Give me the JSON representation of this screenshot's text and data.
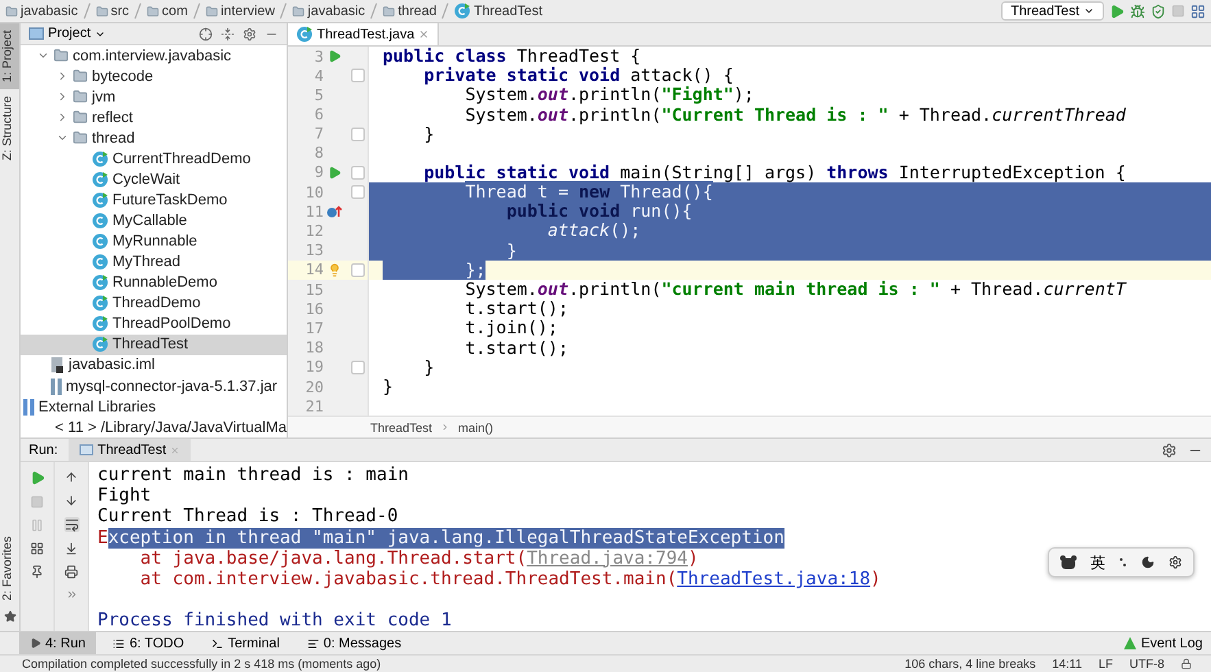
{
  "navigation_bar": {
    "crumbs": [
      "javabasic",
      "src",
      "com",
      "interview",
      "javabasic",
      "thread",
      "ThreadTest"
    ],
    "run_config": "ThreadTest"
  },
  "left_tool_stripe": {
    "top": [
      {
        "label": "1: Project",
        "selected": true
      },
      {
        "label": "Z: Structure",
        "selected": false
      }
    ],
    "bottom": [
      {
        "label": "2: Favorites",
        "selected": false
      }
    ]
  },
  "project_panel": {
    "title": "Project",
    "tree": [
      {
        "label": "com.interview.javabasic",
        "kind": "package",
        "expanded": true,
        "selected": false,
        "children": [
          {
            "label": "bytecode",
            "kind": "package",
            "expanded": false,
            "selected": false
          },
          {
            "label": "jvm",
            "kind": "package",
            "expanded": false,
            "selected": false
          },
          {
            "label": "reflect",
            "kind": "package",
            "expanded": false,
            "selected": false
          },
          {
            "label": "thread",
            "kind": "package",
            "expanded": true,
            "selected": false,
            "children": [
              {
                "label": "CurrentThreadDemo",
                "kind": "runnable-class",
                "selected": false
              },
              {
                "label": "CycleWait",
                "kind": "runnable-class",
                "selected": false
              },
              {
                "label": "FutureTaskDemo",
                "kind": "runnable-class",
                "selected": false
              },
              {
                "label": "MyCallable",
                "kind": "class",
                "selected": false
              },
              {
                "label": "MyRunnable",
                "kind": "class",
                "selected": false
              },
              {
                "label": "MyThread",
                "kind": "class",
                "selected": false
              },
              {
                "label": "RunnableDemo",
                "kind": "runnable-class",
                "selected": false
              },
              {
                "label": "ThreadDemo",
                "kind": "runnable-class",
                "selected": false
              },
              {
                "label": "ThreadPoolDemo",
                "kind": "runnable-class",
                "selected": false
              },
              {
                "label": "ThreadTest",
                "kind": "runnable-class",
                "selected": true
              }
            ]
          }
        ]
      },
      {
        "label": "javabasic.iml",
        "kind": "iml",
        "selected": false
      },
      {
        "label": "mysql-connector-java-5.1.37.jar",
        "kind": "jar",
        "selected": false
      },
      {
        "label": "External Libraries",
        "kind": "libraries",
        "selected": false
      },
      {
        "label": "< 11 >  /Library/Java/JavaVirtualMa",
        "kind": "sdk",
        "selected": false
      }
    ]
  },
  "editor": {
    "tabs": [
      {
        "label": "ThreadTest.java",
        "selected": true
      }
    ],
    "lines": [
      {
        "number": "3",
        "gutter_icon": {
          "kind": "run"
        },
        "tokens": [
          {
            "text": "public class ",
            "kind": "keyword"
          },
          {
            "text": "ThreadTest {",
            "kind": "plain"
          }
        ]
      },
      {
        "number": "4",
        "fold": true,
        "tokens": [
          {
            "text": "    private static void ",
            "kind": "keyword"
          },
          {
            "text": "attack() {",
            "kind": "plain"
          }
        ]
      },
      {
        "number": "5",
        "tokens": [
          {
            "text": "        System.",
            "kind": "plain"
          },
          {
            "text": "out",
            "kind": "field"
          },
          {
            "text": ".println(",
            "kind": "plain"
          },
          {
            "text": "\"Fight\"",
            "kind": "string"
          },
          {
            "text": ");",
            "kind": "plain"
          }
        ]
      },
      {
        "number": "6",
        "tokens": [
          {
            "text": "        System.",
            "kind": "plain"
          },
          {
            "text": "out",
            "kind": "field"
          },
          {
            "text": ".println(",
            "kind": "plain"
          },
          {
            "text": "\"Current Thread is : \"",
            "kind": "string"
          },
          {
            "text": " + Thread.",
            "kind": "plain"
          },
          {
            "text": "currentThread",
            "kind": "call"
          }
        ]
      },
      {
        "number": "7",
        "fold": true,
        "tokens": [
          {
            "text": "    }",
            "kind": "plain"
          }
        ]
      },
      {
        "number": "8"
      },
      {
        "number": "9",
        "gutter_icon": {
          "kind": "run"
        },
        "fold": true,
        "tokens": [
          {
            "text": "    public static void ",
            "kind": "keyword"
          },
          {
            "text": "main(String[] args) ",
            "kind": "plain"
          },
          {
            "text": "throws ",
            "kind": "keyword"
          },
          {
            "text": "InterruptedException {",
            "kind": "plain"
          }
        ]
      },
      {
        "number": "10",
        "fold": true,
        "to_end": true,
        "tokens": [
          {
            "text": "        Thread t = ",
            "kind": "plain",
            "selected": true
          },
          {
            "text": "new ",
            "kind": "keyword",
            "selected": true
          },
          {
            "text": "Thread(){",
            "kind": "plain",
            "selected": true
          }
        ]
      },
      {
        "number": "11",
        "gutter_icon": {
          "kind": "override"
        },
        "to_end": true,
        "tokens": [
          {
            "text": "            public void ",
            "kind": "keyword",
            "selected": true
          },
          {
            "text": "run(){",
            "kind": "plain",
            "selected": true
          }
        ]
      },
      {
        "number": "12",
        "to_end": true,
        "tokens": [
          {
            "text": "                attack",
            "kind": "call",
            "selected": true
          },
          {
            "text": "();",
            "kind": "plain",
            "selected": true
          }
        ]
      },
      {
        "number": "13",
        "to_end": true,
        "tokens": [
          {
            "text": "            }",
            "kind": "plain",
            "selected": true
          }
        ]
      },
      {
        "number": "14",
        "gutter_icon": {
          "kind": "bulb"
        },
        "fold": true,
        "current": true,
        "to_end": false,
        "tokens": [
          {
            "text": "        };",
            "kind": "plain",
            "selected": true
          }
        ]
      },
      {
        "number": "15",
        "tokens": [
          {
            "text": "        System.",
            "kind": "plain"
          },
          {
            "text": "out",
            "kind": "field"
          },
          {
            "text": ".println(",
            "kind": "plain"
          },
          {
            "text": "\"current main thread is : \"",
            "kind": "string"
          },
          {
            "text": " + Thread.",
            "kind": "plain"
          },
          {
            "text": "currentT",
            "kind": "call"
          }
        ]
      },
      {
        "number": "16",
        "tokens": [
          {
            "text": "        t.start();",
            "kind": "plain"
          }
        ]
      },
      {
        "number": "17",
        "tokens": [
          {
            "text": "        t.join();",
            "kind": "plain"
          }
        ]
      },
      {
        "number": "18",
        "tokens": [
          {
            "text": "        t.start();",
            "kind": "plain"
          }
        ]
      },
      {
        "number": "19",
        "fold": true,
        "tokens": [
          {
            "text": "    }",
            "kind": "plain"
          }
        ]
      },
      {
        "number": "20",
        "tokens": [
          {
            "text": "}",
            "kind": "plain"
          }
        ]
      },
      {
        "number": "21"
      }
    ],
    "breadcrumbs": [
      "ThreadTest",
      "main()"
    ]
  },
  "run_panel": {
    "label": "Run:",
    "tabs": [
      {
        "label": "ThreadTest",
        "selected": true
      }
    ],
    "console": [
      {
        "tokens": [
          {
            "text": "current main thread is : main",
            "kind": "output"
          }
        ]
      },
      {
        "tokens": [
          {
            "text": "Fight",
            "kind": "output"
          }
        ]
      },
      {
        "tokens": [
          {
            "text": "Current Thread is : Thread-0",
            "kind": "output"
          }
        ]
      },
      {
        "tokens": [
          {
            "text": "E",
            "kind": "error"
          },
          {
            "text": "xception in thread \"main\" java.lang.IllegalThreadStateException",
            "kind": "error",
            "selected": true
          }
        ]
      },
      {
        "tokens": [
          {
            "text": "    at java.base/java.lang.Thread.start(",
            "kind": "error"
          },
          {
            "text": "Thread.java:794",
            "kind": "muted-link"
          },
          {
            "text": ")",
            "kind": "error"
          }
        ]
      },
      {
        "tokens": [
          {
            "text": "    at com.interview.javabasic.thread.ThreadTest.main(",
            "kind": "error"
          },
          {
            "text": "ThreadTest.java:18",
            "kind": "link"
          },
          {
            "text": ")",
            "kind": "error"
          }
        ]
      },
      {
        "gap_before": true,
        "tokens": [
          {
            "text": "Process finished with exit code 1",
            "kind": "info"
          }
        ]
      }
    ]
  },
  "ime_toolbar": {
    "label": "英"
  },
  "tool_window_bar": {
    "tabs": [
      {
        "label": "4: Run",
        "kind": "run",
        "selected": true
      },
      {
        "label": "6: TODO",
        "kind": "todo",
        "selected": false
      },
      {
        "label": "Terminal",
        "kind": "terminal",
        "selected": false
      },
      {
        "label": "0: Messages",
        "kind": "messages",
        "selected": false
      }
    ],
    "event_log": "Event Log"
  },
  "status_bar": {
    "message": "Compilation completed successfully in 2 s 418 ms (moments ago)",
    "selection": "106 chars, 4 line breaks",
    "position": "14:11",
    "line_separator": "LF",
    "encoding": "UTF-8"
  }
}
